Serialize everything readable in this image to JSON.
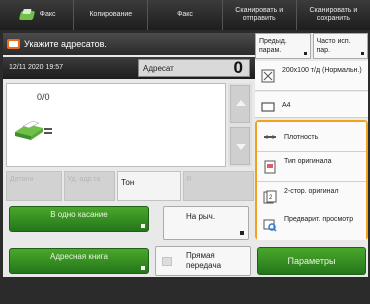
{
  "tabs": [
    {
      "label": "Факс",
      "icon": "home-icon"
    },
    {
      "label": "Копирование"
    },
    {
      "label": "Факс"
    },
    {
      "label": "Сканировать и отправить"
    },
    {
      "label": "Сканировать и сохранить"
    }
  ],
  "prompt": "Укажите адресатов.",
  "datetime": "12/11 2020 19:57",
  "addressee": {
    "label": "Адресат",
    "count": "0"
  },
  "destination": {
    "ratio": "0/0"
  },
  "row_buttons": [
    "Детали",
    "Уд. адр.та",
    "Тон",
    "R"
  ],
  "buttons": {
    "one_touch": "В одно касание",
    "address_book": "Адресная книга",
    "on_hook": "На рыч.",
    "direct_send": "Прямая передача",
    "parameters": "Параметры"
  },
  "settings": {
    "prev": "Предыд. парам.",
    "freq": "Часто исп. пар.",
    "resolution": "200x100 т/д (Нормальн.)",
    "paper": "A4",
    "density": "Плотность",
    "orig_type": "Тип оригинала",
    "duplex": "2-стор. оригинал",
    "preview": "Предварит. просмотр"
  },
  "colors": {
    "accent_green": "#2e8b22",
    "highlight": "#f0a21e",
    "mail": "#e86e1e"
  }
}
